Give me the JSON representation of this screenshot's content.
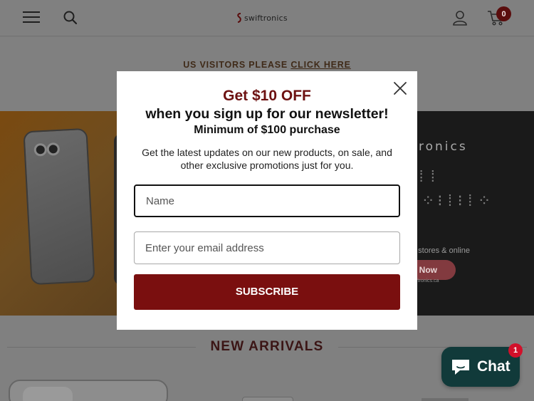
{
  "header": {
    "logo_text": "swiftronics",
    "cart_count": "0",
    "icons": [
      "menu-icon",
      "search-icon",
      "user-icon",
      "cart-icon"
    ]
  },
  "announcement": {
    "text": "US VISITORS PLEASE ",
    "link": "CLICK HERE"
  },
  "hero": {
    "brand_fragment": "ronics",
    "stores_text": "n stores & online",
    "shop_now_fragment": "p Now",
    "url_fragment": "wiftronics.ca"
  },
  "section": {
    "title": "NEW ARRIVALS"
  },
  "modal": {
    "title": "Get $10 OFF",
    "subtitle": "when you sign up for our newsletter!",
    "minimum": "Minimum of $100 purchase",
    "description": "Get the latest updates on our new products, on sale, and other exclusive promotions just for you.",
    "name_placeholder": "Name",
    "email_placeholder": "Enter your email address",
    "subscribe_label": "SUBSCRIBE",
    "accent_color": "#7a0f0f"
  },
  "chat": {
    "label": "Chat",
    "badge": "1",
    "color": "#113a3a"
  }
}
